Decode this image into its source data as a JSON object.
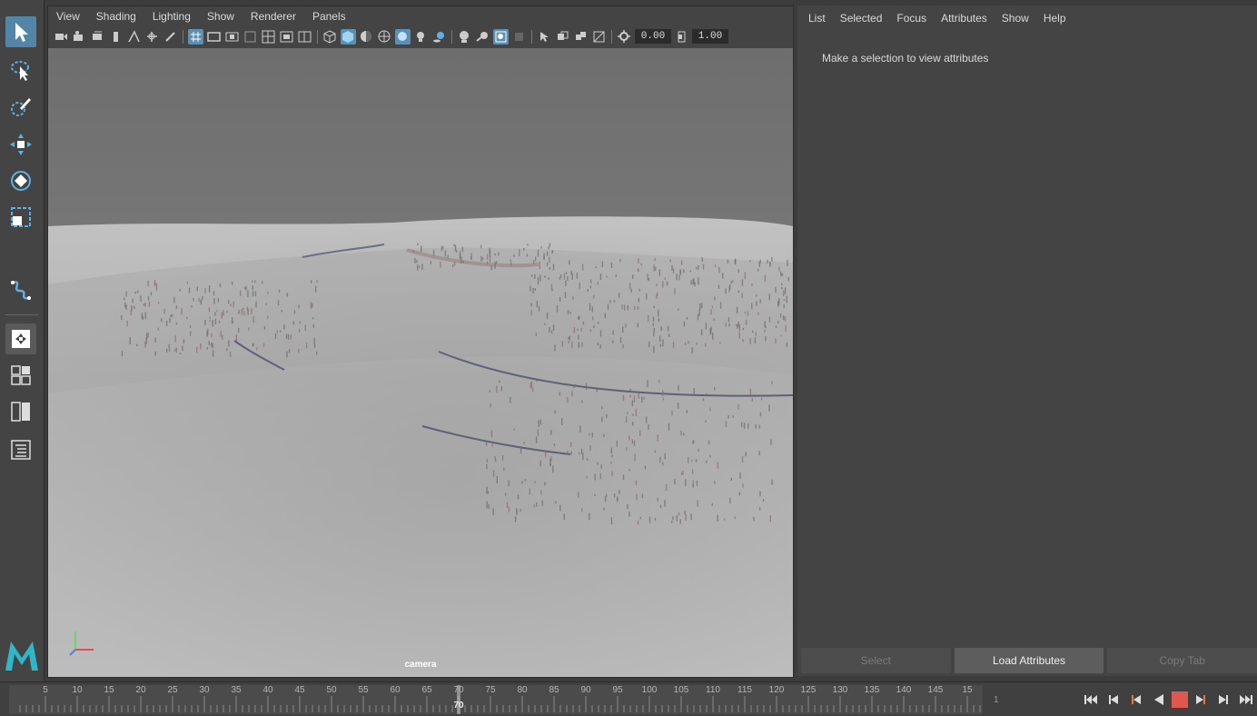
{
  "viewport_panel": {
    "menus": [
      "View",
      "Shading",
      "Lighting",
      "Show",
      "Renderer",
      "Panels"
    ],
    "exposure": "0.00",
    "gamma": "1.00",
    "camera_label": "camera"
  },
  "toolbox": {
    "tools": [
      "select-tool",
      "lasso-tool",
      "paint-select-tool",
      "move-tool",
      "rotate-tool",
      "scale-tool",
      "curve-tool",
      "single-pane-layout",
      "four-pane-layout",
      "two-pane-layout",
      "outliner"
    ],
    "active_tool": "select-tool"
  },
  "attribute_editor": {
    "menus": [
      "List",
      "Selected",
      "Focus",
      "Attributes",
      "Show",
      "Help"
    ],
    "message": "Make a selection to view attributes",
    "buttons": {
      "select": "Select",
      "load_attributes": "Load Attributes",
      "copy_tab": "Copy Tab"
    }
  },
  "timeline": {
    "ticks": [
      "5",
      "10",
      "15",
      "20",
      "25",
      "30",
      "35",
      "40",
      "45",
      "50",
      "55",
      "60",
      "65",
      "70",
      "75",
      "80",
      "85",
      "90",
      "95",
      "100",
      "105",
      "110",
      "115",
      "120",
      "125",
      "130",
      "135",
      "140",
      "145",
      "15"
    ],
    "current_frame": "70",
    "range_start": "1"
  },
  "playback_controls": [
    "go-to-start",
    "step-back-frame",
    "step-back-key",
    "play-backwards",
    "stop",
    "step-forward-key",
    "step-forward-frame",
    "go-to-end"
  ],
  "colors": {
    "accent": "#5285a6",
    "stop_button": "#e0574f",
    "panel_bg": "#444444",
    "viewport_ground": "#b4b4b4",
    "viewport_sky": "#707070"
  }
}
